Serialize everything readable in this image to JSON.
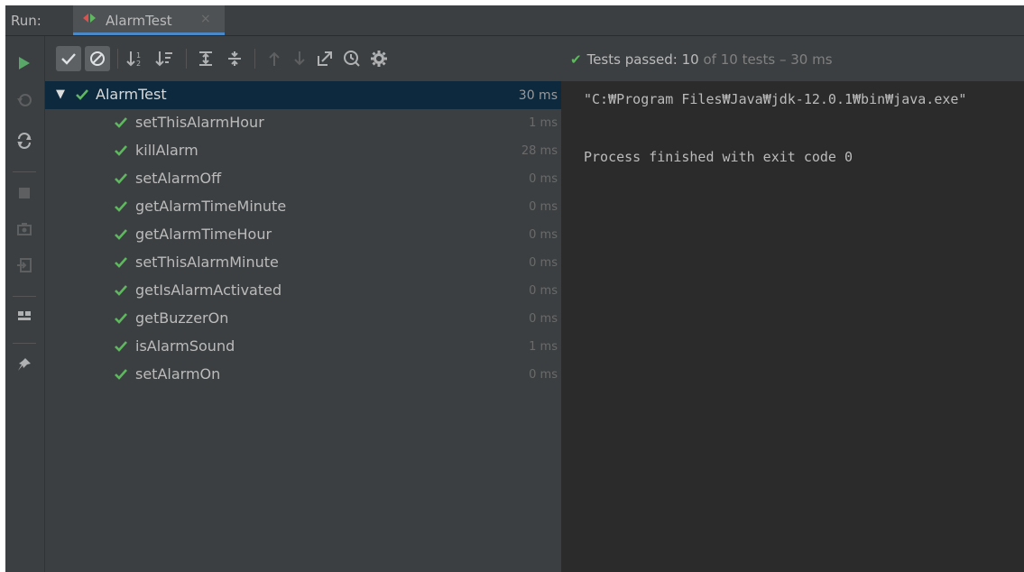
{
  "tabbar": {
    "run_label": "Run:",
    "tab_title": "AlarmTest",
    "tab_close": "×"
  },
  "toolbar": {
    "buttons": [
      {
        "name": "show-passed-icon",
        "active": true
      },
      {
        "name": "show-ignored-icon",
        "active": true
      },
      {
        "name": "sort-alphabetically-icon"
      },
      {
        "name": "sort-by-duration-icon"
      },
      {
        "name": "expand-all-icon"
      },
      {
        "name": "collapse-all-icon"
      },
      {
        "name": "previous-failed-icon"
      },
      {
        "name": "next-failed-icon"
      },
      {
        "name": "export-icon"
      },
      {
        "name": "history-icon"
      },
      {
        "name": "settings-icon"
      }
    ]
  },
  "status": {
    "check": "✔",
    "label": "Tests passed: ",
    "passed": "10",
    "of_text": " of 10 tests",
    "duration": " – 30 ms"
  },
  "tree": {
    "root": {
      "name": "AlarmTest",
      "duration": "30 ms"
    },
    "tests": [
      {
        "name": "setThisAlarmHour",
        "duration": "1 ms"
      },
      {
        "name": "killAlarm",
        "duration": "28 ms"
      },
      {
        "name": "setAlarmOff",
        "duration": "0 ms"
      },
      {
        "name": "getAlarmTimeMinute",
        "duration": "0 ms"
      },
      {
        "name": "getAlarmTimeHour",
        "duration": "0 ms"
      },
      {
        "name": "setThisAlarmMinute",
        "duration": "0 ms"
      },
      {
        "name": "getIsAlarmActivated",
        "duration": "0 ms"
      },
      {
        "name": "getBuzzerOn",
        "duration": "0 ms"
      },
      {
        "name": "isAlarmSound",
        "duration": "1 ms"
      },
      {
        "name": "setAlarmOn",
        "duration": "0 ms"
      }
    ]
  },
  "console": {
    "line1": "\"C:₩Program Files₩Java₩jdk-12.0.1₩bin₩java.exe\"",
    "line2": "Process finished with exit code 0"
  },
  "colors": {
    "pass_green": "#5fb85f",
    "selection": "#0d293e",
    "panel": "#3c3f41",
    "console_bg": "#2b2b2b"
  }
}
